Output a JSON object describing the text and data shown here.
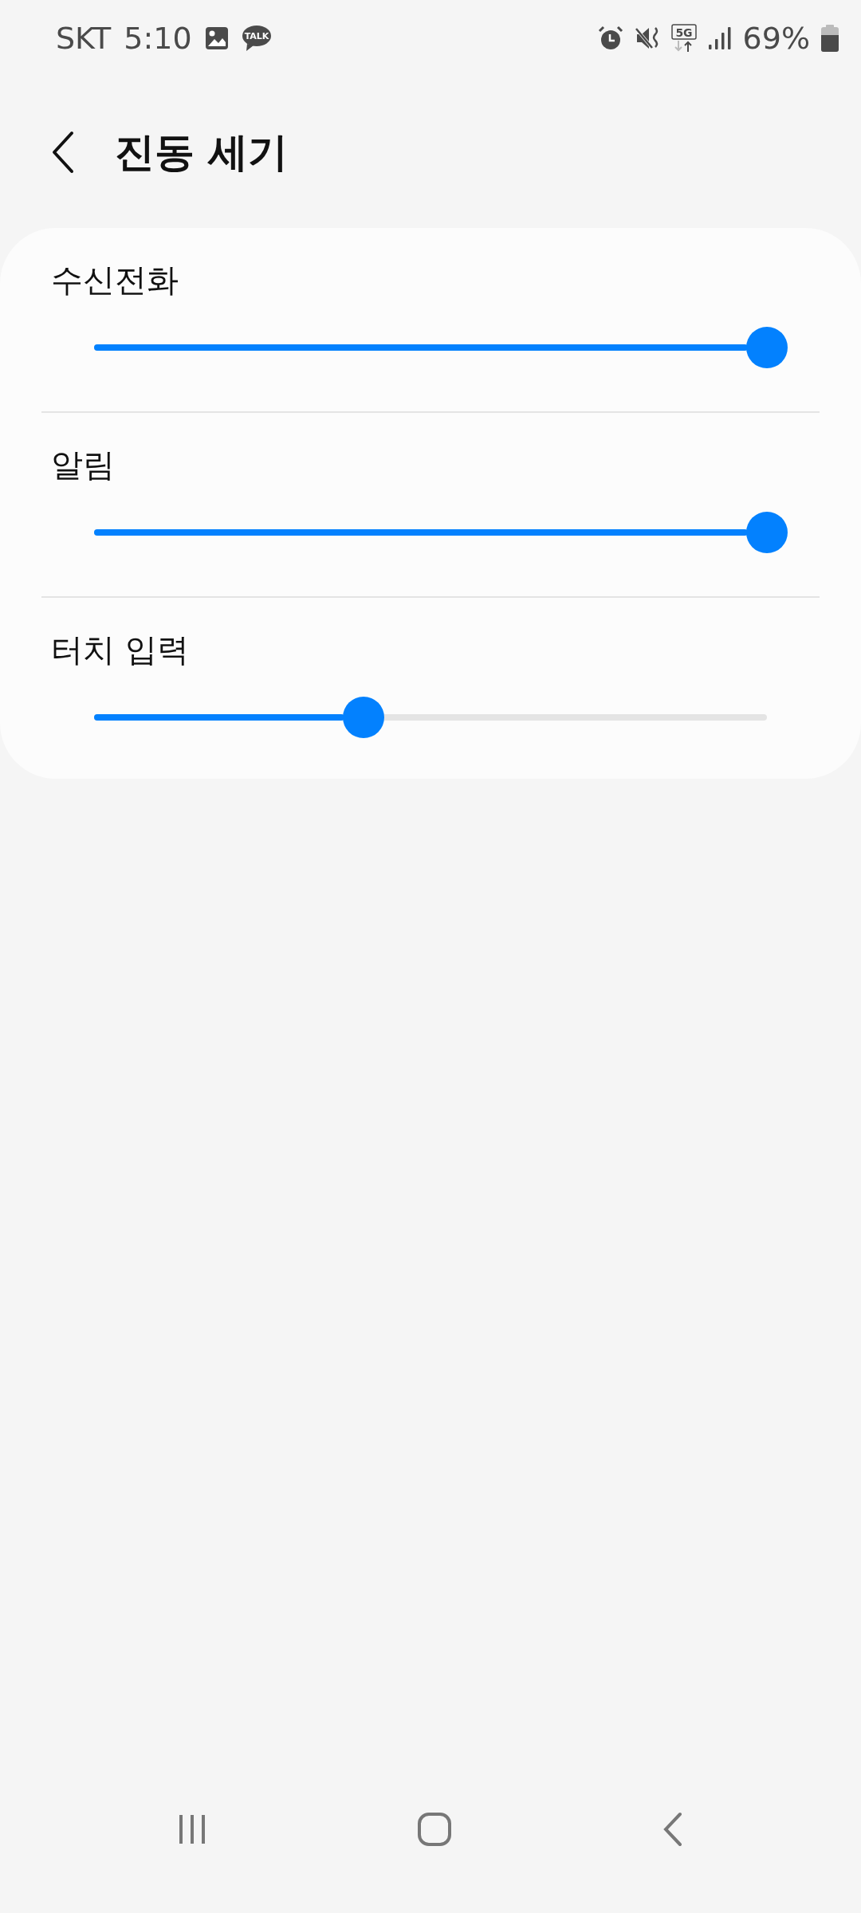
{
  "status_bar": {
    "carrier": "SKT",
    "time": "5:10",
    "talk_label": "TALK",
    "network_type": "5G",
    "battery": "69%"
  },
  "header": {
    "title": "진동 세기"
  },
  "sliders": [
    {
      "label": "수신전화",
      "level": 1.0
    },
    {
      "label": "알림",
      "level": 1.0
    },
    {
      "label": "터치 입력",
      "level": 0.4
    }
  ]
}
